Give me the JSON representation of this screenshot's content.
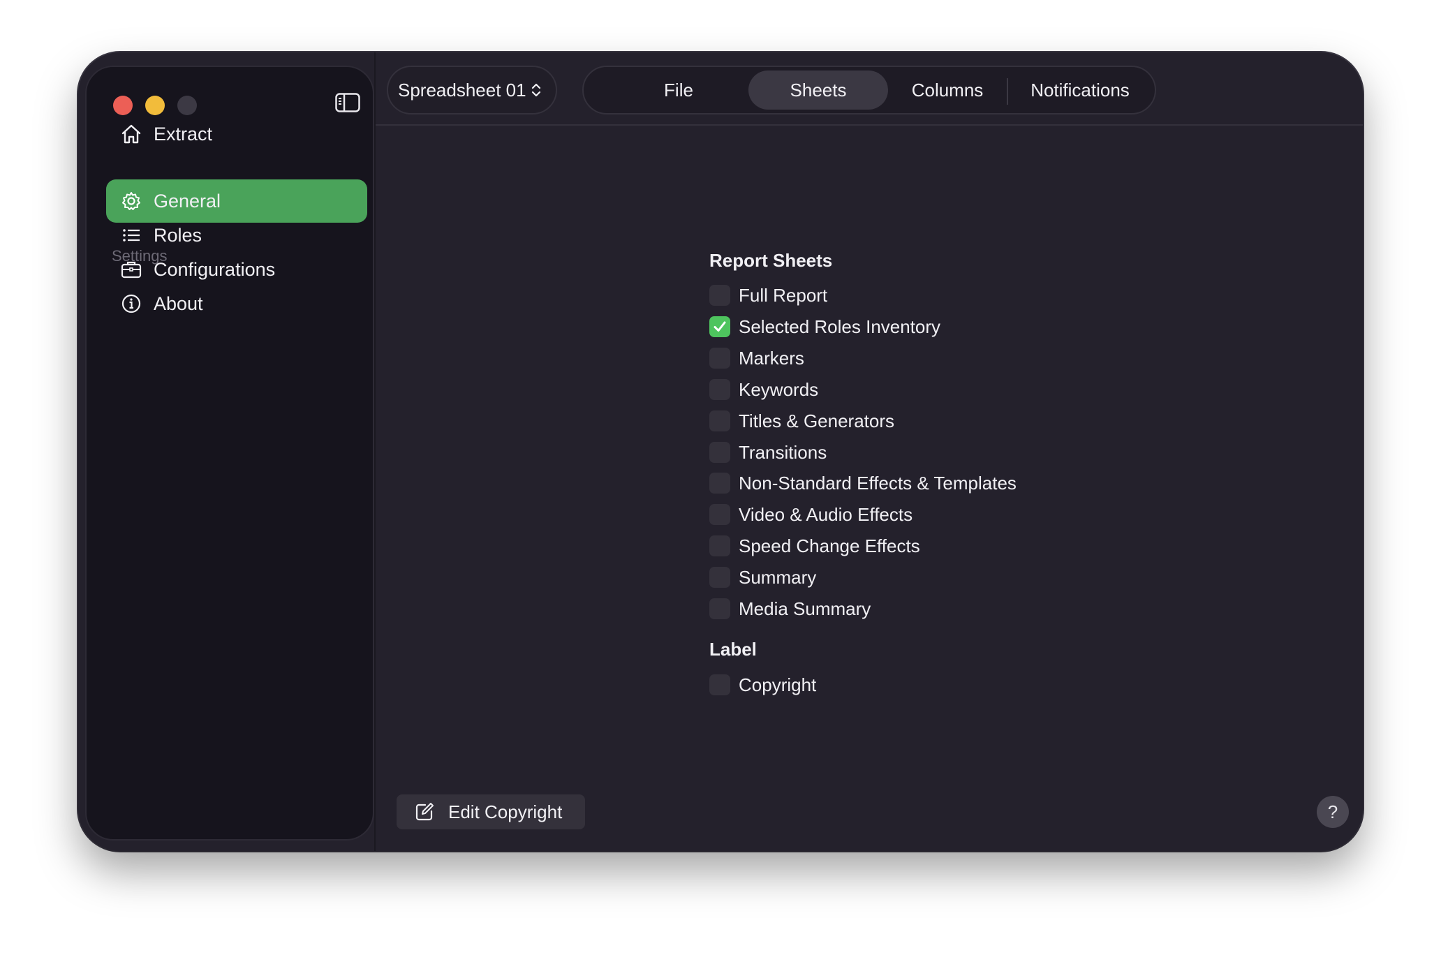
{
  "sidebar": {
    "top_item": {
      "label": "Extract",
      "icon": "house-icon"
    },
    "section_label": "Settings",
    "items": [
      {
        "label": "General",
        "icon": "gear-icon",
        "active": true
      },
      {
        "label": "Roles",
        "icon": "list-icon",
        "active": false
      },
      {
        "label": "Configurations",
        "icon": "briefcase-icon",
        "active": false
      },
      {
        "label": "About",
        "icon": "info-icon",
        "active": false
      }
    ]
  },
  "toolbar": {
    "document_select": "Spreadsheet 01",
    "tabs": [
      "File",
      "Sheets",
      "Columns",
      "Notifications"
    ],
    "active_tab": "Sheets"
  },
  "report_sheets": {
    "title": "Report Sheets",
    "options": [
      {
        "label": "Full Report",
        "checked": false
      },
      {
        "label": "Selected Roles Inventory",
        "checked": true
      },
      {
        "label": "Markers",
        "checked": false
      },
      {
        "label": "Keywords",
        "checked": false
      },
      {
        "label": "Titles & Generators",
        "checked": false
      },
      {
        "label": "Transitions",
        "checked": false
      },
      {
        "label": "Non-Standard Effects & Templates",
        "checked": false
      },
      {
        "label": "Video & Audio Effects",
        "checked": false
      },
      {
        "label": "Speed Change Effects",
        "checked": false
      },
      {
        "label": "Summary",
        "checked": false
      },
      {
        "label": "Media Summary",
        "checked": false
      }
    ]
  },
  "label_group": {
    "title": "Label",
    "options": [
      {
        "label": "Copyright",
        "checked": false
      }
    ]
  },
  "footer": {
    "edit_button": "Edit Copyright",
    "help": "?"
  },
  "colors": {
    "accent": "#4aa35a",
    "checkbox_checked": "#4ec45e",
    "window_bg": "#24212c",
    "sidebar_bg": "#16141d"
  }
}
